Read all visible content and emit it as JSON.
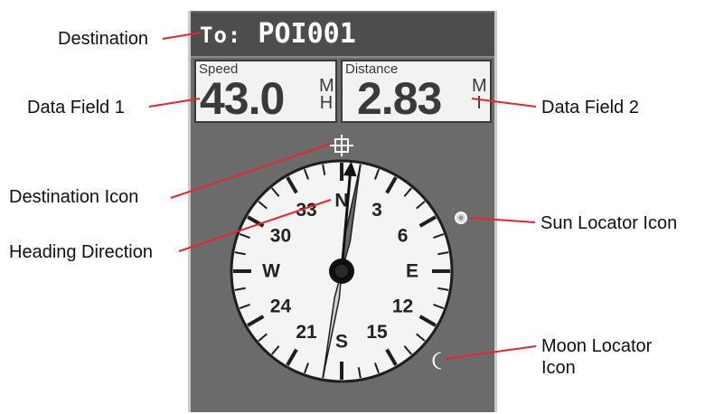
{
  "header": {
    "prefix": "To:",
    "destination": "POI001"
  },
  "data_field_1": {
    "label": "Speed",
    "value": "43.0",
    "unit_top": "M",
    "unit_bottom": "H"
  },
  "data_field_2": {
    "label": "Distance",
    "value": "2.83",
    "unit_top": "M",
    "unit_bottom": "I"
  },
  "compass": {
    "labels": [
      {
        "text": "N",
        "bearing": 0
      },
      {
        "text": "3",
        "bearing": 30
      },
      {
        "text": "6",
        "bearing": 60
      },
      {
        "text": "E",
        "bearing": 90
      },
      {
        "text": "12",
        "bearing": 120
      },
      {
        "text": "15",
        "bearing": 150
      },
      {
        "text": "S",
        "bearing": 180
      },
      {
        "text": "21",
        "bearing": 210
      },
      {
        "text": "24",
        "bearing": 240
      },
      {
        "text": "W",
        "bearing": 270
      },
      {
        "text": "30",
        "bearing": 300
      },
      {
        "text": "33",
        "bearing": 330
      }
    ],
    "heading_degrees": 5,
    "bearing_to_destination_degrees": 10
  },
  "callouts": {
    "destination": "Destination",
    "data_field_1": "Data Field 1",
    "data_field_2": "Data Field 2",
    "destination_icon": "Destination Icon",
    "heading_direction": "Heading Direction",
    "sun_locator_icon": "Sun Locator Icon",
    "moon_locator_line1": "Moon Locator",
    "moon_locator_line2": "Icon"
  },
  "colors": {
    "callout_line": "#e0282e",
    "screen_background": "#6b6b6b",
    "title_bar": "#4d4d4d",
    "field_background": "#f2f2f2",
    "compass_face": "#f4f4f4",
    "ink": "#222222"
  }
}
